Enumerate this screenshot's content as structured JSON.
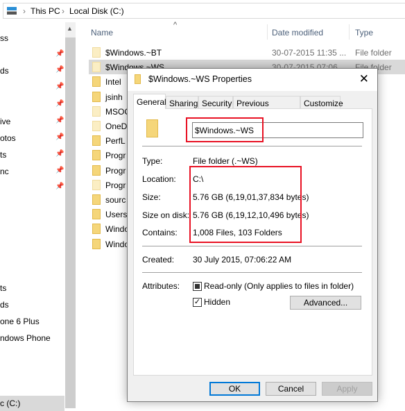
{
  "address": {
    "crumbs": [
      "This PC",
      "Local Disk (C:)"
    ],
    "pc_icon": "this-pc-icon"
  },
  "nav": {
    "items": [
      {
        "label": "ss",
        "pinned": false
      },
      {
        "label": "",
        "pinned": true
      },
      {
        "label": "ds",
        "pinned": true
      },
      {
        "label": "",
        "pinned": true
      },
      {
        "label": "",
        "pinned": true
      },
      {
        "label": "ive",
        "pinned": true
      },
      {
        "label": "otos",
        "pinned": true
      },
      {
        "label": "ts",
        "pinned": true
      },
      {
        "label": "nc",
        "pinned": true
      },
      {
        "label": "",
        "pinned": true
      }
    ],
    "lower_items": [
      "ts",
      "ds",
      "one 6 Plus",
      "ndows Phone"
    ],
    "selected": "c (C:)"
  },
  "list": {
    "columns": [
      "Name",
      "Date modified",
      "Type"
    ],
    "rows": [
      {
        "name": "$Windows.~BT",
        "date": "30-07-2015 11:35 ...",
        "type": "File folder",
        "hidden": true
      },
      {
        "name": "$Windows.~WS",
        "date": "30-07-2015 07:06",
        "type": "File folder",
        "hidden": true,
        "selected": true
      },
      {
        "name": "Intel",
        "hidden": false
      },
      {
        "name": "jsinh",
        "hidden": false
      },
      {
        "name": "MSOC",
        "hidden": true
      },
      {
        "name": "OneD",
        "hidden": true
      },
      {
        "name": "PerfL",
        "hidden": false
      },
      {
        "name": "Progr",
        "hidden": false
      },
      {
        "name": "Progr",
        "hidden": false
      },
      {
        "name": "Progr",
        "hidden": true
      },
      {
        "name": "sourc",
        "hidden": false
      },
      {
        "name": "Users",
        "hidden": false
      },
      {
        "name": "Windo",
        "hidden": false
      },
      {
        "name": "Windo",
        "hidden": false
      }
    ]
  },
  "dialog": {
    "title": "$Windows.~WS Properties",
    "close": "✕",
    "tabs": [
      "General",
      "Sharing",
      "Security",
      "Previous Versions",
      "Customize"
    ],
    "active_tab": "General",
    "name_value": "$Windows.~WS",
    "fields": {
      "type_label": "Type:",
      "type_value": "File folder (.~WS)",
      "location_label": "Location:",
      "location_value": "C:\\",
      "size_label": "Size:",
      "size_value": "5.76 GB (6,19,01,37,834 bytes)",
      "disk_label": "Size on disk:",
      "disk_value": "5.76 GB (6,19,12,10,496 bytes)",
      "contains_label": "Contains:",
      "contains_value": "1,008 Files, 103 Folders",
      "created_label": "Created:",
      "created_value": "30 July 2015, 07:06:22 AM",
      "attributes_label": "Attributes:"
    },
    "readonly": {
      "label": "Read-only (Only applies to files in folder)",
      "state": "indeterminate"
    },
    "hidden": {
      "label": "Hidden",
      "checked": true
    },
    "advanced": "Advanced...",
    "buttons": {
      "ok": "OK",
      "cancel": "Cancel",
      "apply": "Apply"
    },
    "highlight_color": "#e81123"
  }
}
